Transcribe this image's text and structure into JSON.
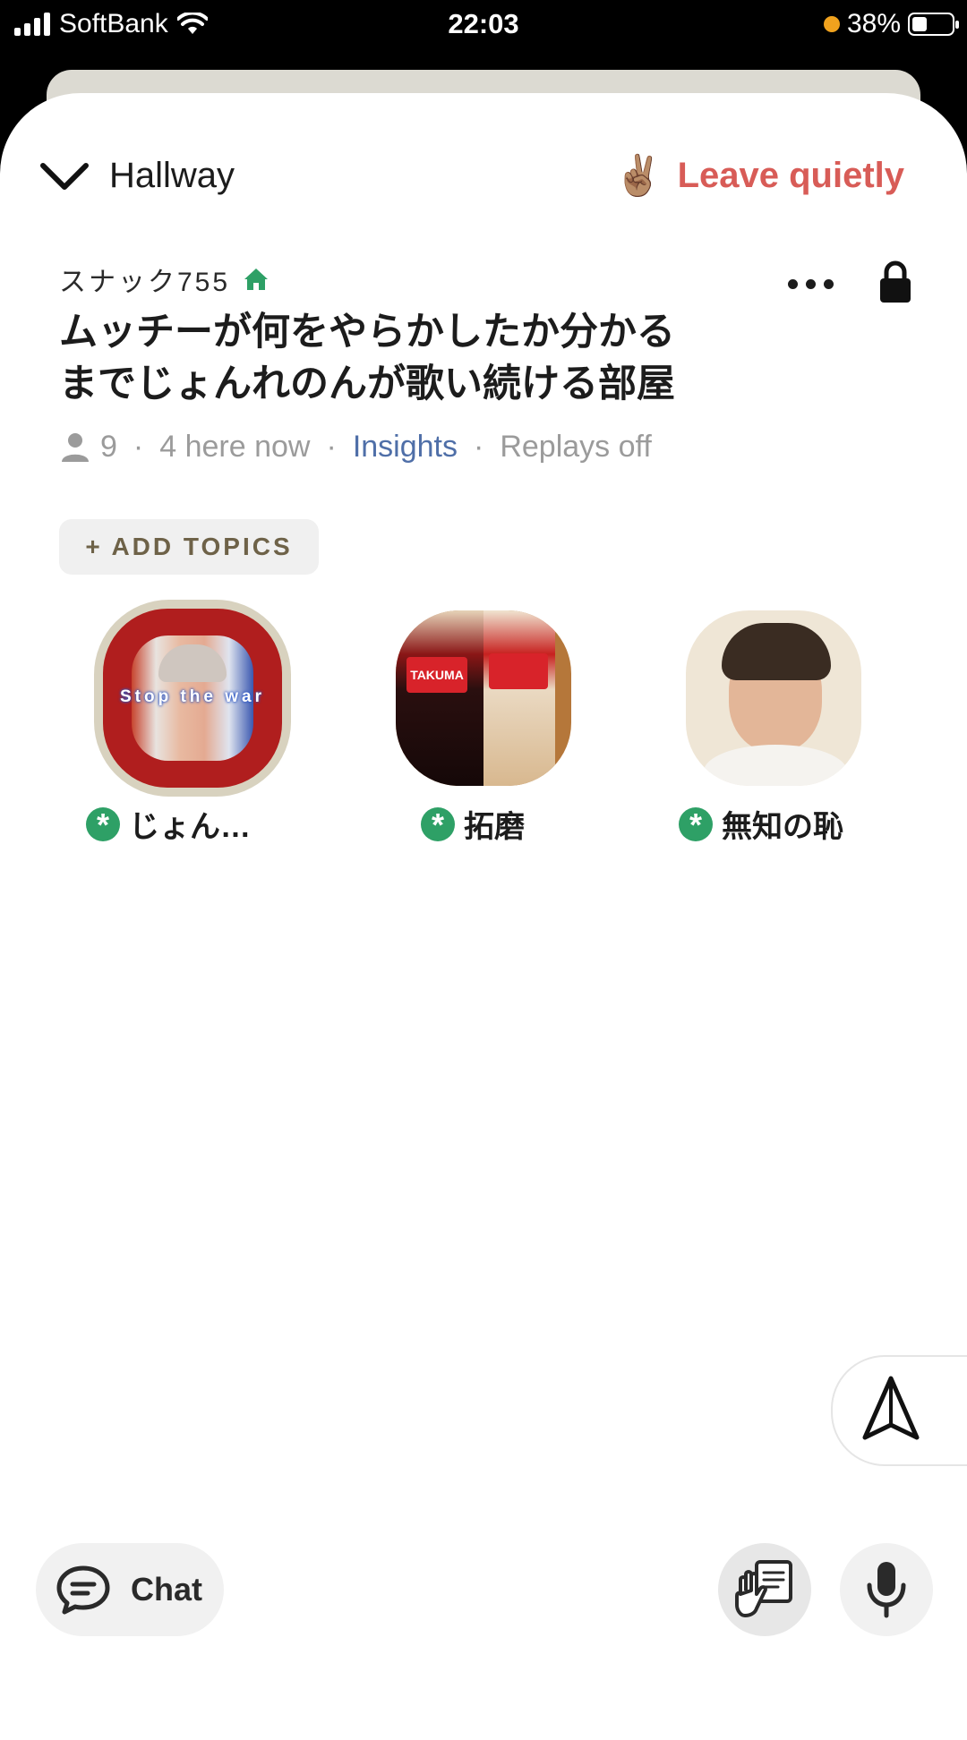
{
  "status_bar": {
    "carrier": "SoftBank",
    "time": "22:03",
    "battery": "38%",
    "battery_level": 0.38
  },
  "header": {
    "back_label": "Hallway",
    "leave_label": "Leave quietly",
    "leave_emoji": "✌🏽"
  },
  "room": {
    "club_name": "スナック755",
    "title_line1": "ムッチーが何をやらかしたか分かる",
    "title_line2": "までじょんれのんが歌い続ける部屋",
    "listener_count": "9",
    "here_now": "4 here now",
    "insights_label": "Insights",
    "replays": "Replays off",
    "add_topics": "+ ADD TOPICS"
  },
  "speakers": [
    {
      "name": "じょん…",
      "avatar_overlay": "Stop the war",
      "speaking": true
    },
    {
      "name": "拓磨",
      "avatar_overlay": "TAKUMA",
      "speaking": false
    },
    {
      "name": "無知の恥",
      "speaking": false
    }
  ],
  "bottom_bar": {
    "chat_label": "Chat"
  },
  "colors": {
    "accent_red": "#d85c57",
    "link_blue": "#4f6fa8",
    "moderator_green": "#2ea066",
    "club_home_green": "#2ea066",
    "speaking_ring": "#d8d2bf"
  },
  "icons": [
    "chevron-down-icon",
    "peace-hand-icon",
    "house-icon",
    "more-icon",
    "lock-icon",
    "person-icon",
    "moderator-icon",
    "share-plane-icon",
    "chat-bubble-icon",
    "raise-hand-icon",
    "microphone-icon"
  ]
}
